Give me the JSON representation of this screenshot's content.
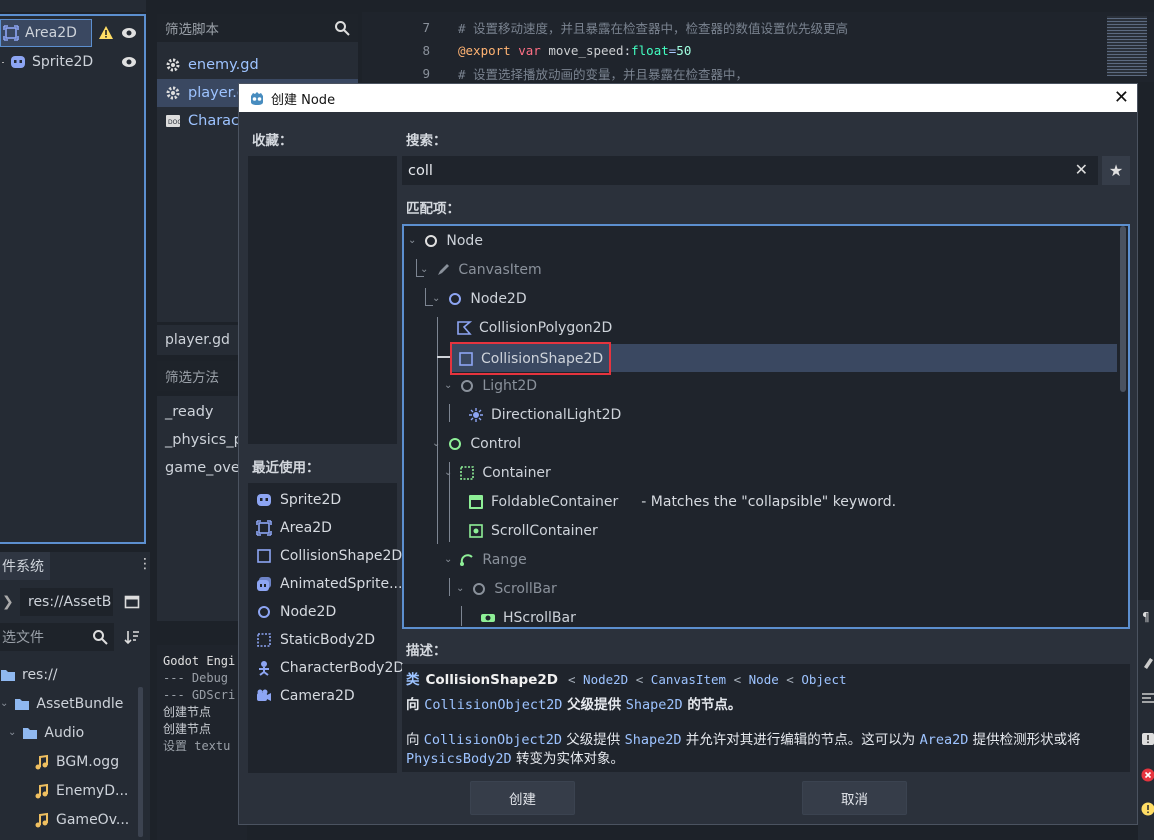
{
  "scene_tree": {
    "items": [
      {
        "label": "Area2D"
      },
      {
        "label": "Sprite2D"
      }
    ]
  },
  "script_panel": {
    "filter_placeholder": "筛选脚本",
    "items": [
      "enemy.gd",
      "player.gd",
      "Charact"
    ],
    "current_script": "player.gd",
    "filter_methods": "筛选方法",
    "methods": [
      "_ready",
      "_physics_pr",
      "game_over"
    ]
  },
  "filesystem": {
    "tab": "件系统",
    "path": "res://AssetB",
    "filter_placeholder": "选文件",
    "items": [
      "res://",
      "AssetBundle",
      "Audio",
      "BGM.ogg",
      "EnemyD...",
      "GameOv..."
    ]
  },
  "output": {
    "lines": [
      "Godot Engi",
      "--- Debug",
      "--- GDScri",
      "创建节点",
      "创建节点",
      "设置 textu"
    ]
  },
  "code": {
    "lines": [
      {
        "num": "7",
        "text": "#  设置移动速度，并且暴露在检查器中，检查器的数值设置优先级更高",
        "type": "comment"
      },
      {
        "num": "8",
        "text": "",
        "type": "code"
      },
      {
        "num": "9",
        "text": "#  设置选择播放动画的变量，并且暴露在检查器中，",
        "type": "comment"
      }
    ],
    "line8": {
      "annotation": "@export",
      "kw": "var",
      "name": "move_speed",
      "colon": ":",
      "typ": "float",
      "eq": "=",
      "val": "50"
    }
  },
  "dialog": {
    "title": "创建 Node",
    "favorites_label": "收藏：",
    "recent_label": "最近使用：",
    "search_label": "搜索：",
    "search_value": "coll",
    "matches_label": "匹配项：",
    "description_label": "描述：",
    "create_button": "创建",
    "cancel_button": "取消",
    "recent": [
      "Sprite2D",
      "Area2D",
      "CollisionShape2D",
      "AnimatedSprite...",
      "Node2D",
      "StaticBody2D",
      "CharacterBody2D",
      "Camera2D"
    ],
    "tree": [
      {
        "label": "Node",
        "note": ""
      },
      {
        "label": "CanvasItem",
        "note": ""
      },
      {
        "label": "Node2D",
        "note": ""
      },
      {
        "label": "CollisionPolygon2D",
        "note": ""
      },
      {
        "label": "CollisionShape2D",
        "note": ""
      },
      {
        "label": "Light2D",
        "note": ""
      },
      {
        "label": "DirectionalLight2D",
        "note": ""
      },
      {
        "label": "Control",
        "note": ""
      },
      {
        "label": "Container",
        "note": ""
      },
      {
        "label": "FoldableContainer",
        "note": "- Matches the \"collapsible\" keyword."
      },
      {
        "label": "ScrollContainer",
        "note": ""
      },
      {
        "label": "Range",
        "note": ""
      },
      {
        "label": "ScrollBar",
        "note": ""
      },
      {
        "label": "HScrollBar",
        "note": ""
      }
    ],
    "desc": {
      "class_word": "类",
      "class_name": "CollisionShape2D",
      "chain": [
        "Node2D",
        "CanvasItem",
        "Node",
        "Object"
      ],
      "sep": "<",
      "p1_a": "向",
      "p1_b": "CollisionObject2D",
      "p1_c": "父级提供",
      "p1_d": "Shape2D",
      "p1_e": "的节点。",
      "p2_a": "向",
      "p2_b": "CollisionObject2D",
      "p2_c": "父级提供",
      "p2_d": "Shape2D",
      "p2_e": "并允许对其进行编辑的节点。这可以为",
      "p2_f": "Area2D",
      "p2_g": "提供检测形状或将",
      "p2_h": "PhysicsBody2D",
      "p2_i": "转变为实体对象。"
    }
  },
  "colors": {
    "accent": "#5c8fcf",
    "selected_row": "#3a4861",
    "highlight_box": "#e5343e",
    "node2d_icon": "#8da5f3",
    "control_icon": "#8eef97",
    "warning": "#ffdd65"
  }
}
